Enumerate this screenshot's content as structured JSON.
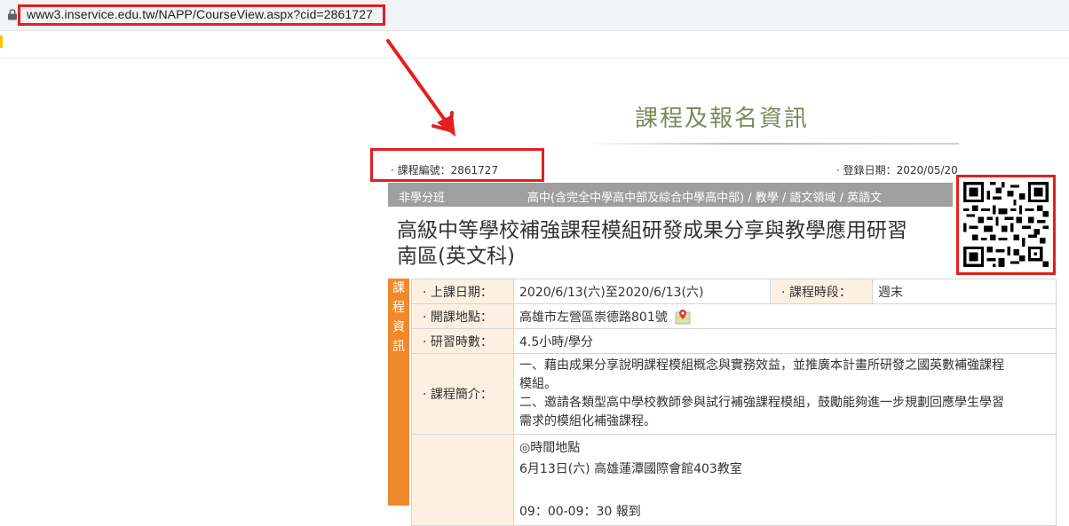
{
  "browser": {
    "url": "www3.inservice.edu.tw/NAPP/CourseView.aspx?cid=2861727"
  },
  "page": {
    "title": "課程及報名資訊",
    "course_id": "· 課程編號：2861727",
    "registration_date": "· 登錄日期：2020/05/20",
    "category_left": "非學分班",
    "category_right": "高中(含完全中學高中部及綜合中學高中部) / 教學 / 語文領域 / 英語文",
    "course_title_line1": "高級中等學校補強課程模組研發成果分享與教學應用研習",
    "course_title_line2": "南區(英文科)",
    "side_tab": [
      "課",
      "程",
      "資",
      "訊"
    ]
  },
  "info": {
    "date_label": "· 上課日期：",
    "date_value": "2020/6/13(六)至2020/6/13(六)",
    "period_label": "· 課程時段：",
    "period_value": "週末",
    "location_label": "· 開課地點：",
    "location_value": "高雄市左營區崇德路801號",
    "hours_label": "· 研習時數：",
    "hours_value": "4.5小時/學分",
    "intro_label": "· 課程簡介：",
    "intro_lines": [
      "一、藉由成果分享說明課程模組概念與實務效益，並推廣本計畫所研發之國英數補強課程",
      "模組。",
      "二、邀請各類型高中學校教師參與試行補強課程模組，鼓勵能夠進一步規劃回應學生學習",
      "需求的模組化補強課程。"
    ],
    "schedule_lines": [
      "◎時間地點",
      "6月13日(六) 高雄蓮潭國際會館403教室",
      "",
      "09：00-09：30 報到"
    ]
  },
  "colors": {
    "annotation_red": "#e21f1f",
    "title_olive": "#7b8a58",
    "side_orange": "#f0882c",
    "category_gray": "#9f9f9f",
    "label_bg": "#fdf0e2"
  }
}
